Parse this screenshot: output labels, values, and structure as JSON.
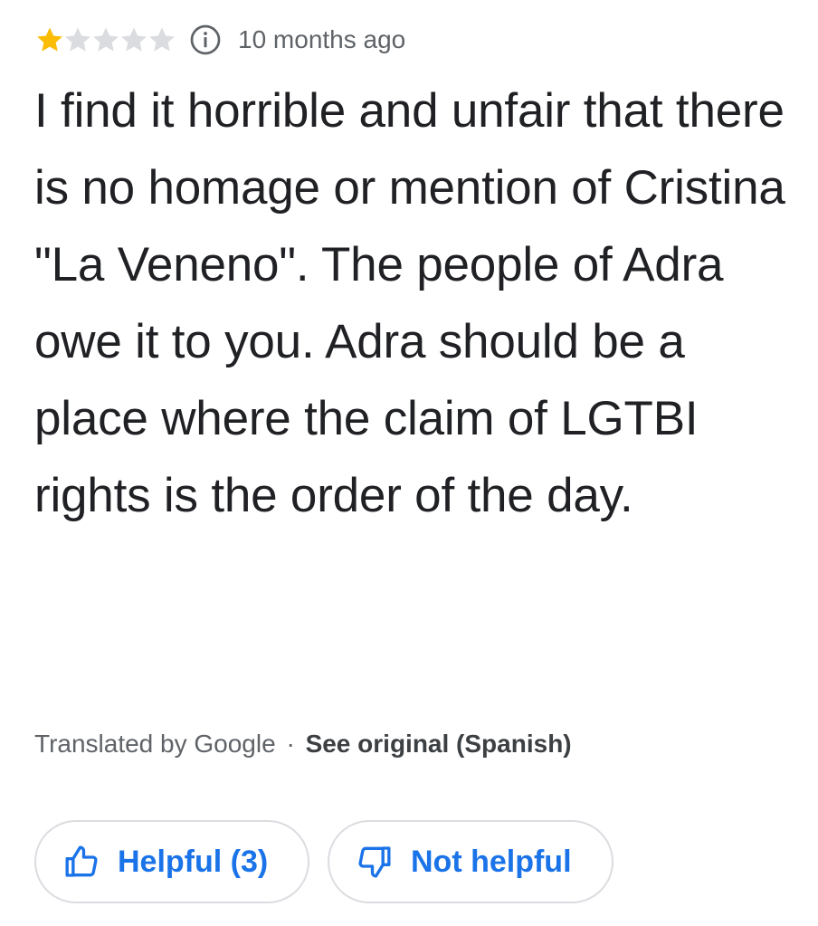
{
  "rating": {
    "value": 1,
    "max": 5,
    "filled_color": "#fbbc04",
    "empty_color": "#dadce0",
    "info_icon": "info-icon"
  },
  "timestamp": "10 months ago",
  "review": {
    "text": "I find it horrible and unfair that there is no homage or mention of Cristina \"La Veneno\". The people of Adra owe it to you. Adra should be a place where the claim of LGTBI rights is the order of the day."
  },
  "translation": {
    "note": "Translated by Google",
    "separator": "·",
    "link": "See original (Spanish)"
  },
  "actions": {
    "helpful": {
      "label": "Helpful (3)",
      "icon": "thumbs-up-icon"
    },
    "not_helpful": {
      "label": "Not helpful",
      "icon": "thumbs-down-icon"
    },
    "accent_color": "#1a73e8"
  }
}
